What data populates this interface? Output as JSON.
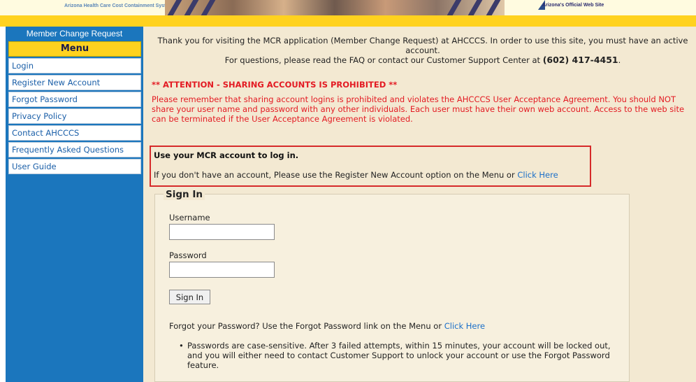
{
  "header": {
    "logo_text": "Arizona Health Care Cost Containment System",
    "az_site_text": "Arizona's Official Web Site"
  },
  "sidebar": {
    "title": "Member Change Request",
    "menu_label": "Menu",
    "items": [
      {
        "label": "Login"
      },
      {
        "label": "Register New Account"
      },
      {
        "label": "Forgot Password"
      },
      {
        "label": "Privacy Policy"
      },
      {
        "label": "Contact AHCCCS"
      },
      {
        "label": "Frequently Asked Questions"
      },
      {
        "label": "User Guide"
      }
    ]
  },
  "main": {
    "intro_line1": "Thank you for visiting the MCR application (Member Change Request) at AHCCCS. In order to use this site, you must have an active account.",
    "intro_line2_prefix": "For questions, please read the FAQ or contact our Customer Support Center at",
    "phone": "(602) 417-4451",
    "intro_line2_suffix": ".",
    "attention": "** ATTENTION - SHARING ACCOUNTS IS PROHIBITED **",
    "warning": "Please remember that sharing account logins is prohibited and violates the AHCCCS User Acceptance Agreement. You should NOT share your user name and password with any other individuals. Each user must have their own web account. Access to the web site can be terminated if the User Acceptance Agreement is violated.",
    "login_box": {
      "title": "Use your MCR account to log in.",
      "text": "If you don't have an account, Please use the Register New Account option on the Menu or",
      "link": "Click Here"
    },
    "signin": {
      "legend": "Sign In",
      "username_label": "Username",
      "username_value": "",
      "password_label": "Password",
      "password_value": "",
      "button_label": "Sign In",
      "forgot_text": "Forgot your Password? Use the Forgot Password link on the Menu or",
      "forgot_link": "Click Here",
      "bullet": "Passwords are case-sensitive. After 3 failed attempts, within 15 minutes, your account will be locked out, and you will either need to contact Customer Support to unlock your account or use the Forgot Password feature."
    }
  },
  "colors": {
    "sidebar_blue": "#1b76bd",
    "menu_yellow": "#ffd21f",
    "main_bg": "#f3e9d2",
    "alert_red": "#e31b23",
    "link_blue": "#1b6fc8"
  }
}
